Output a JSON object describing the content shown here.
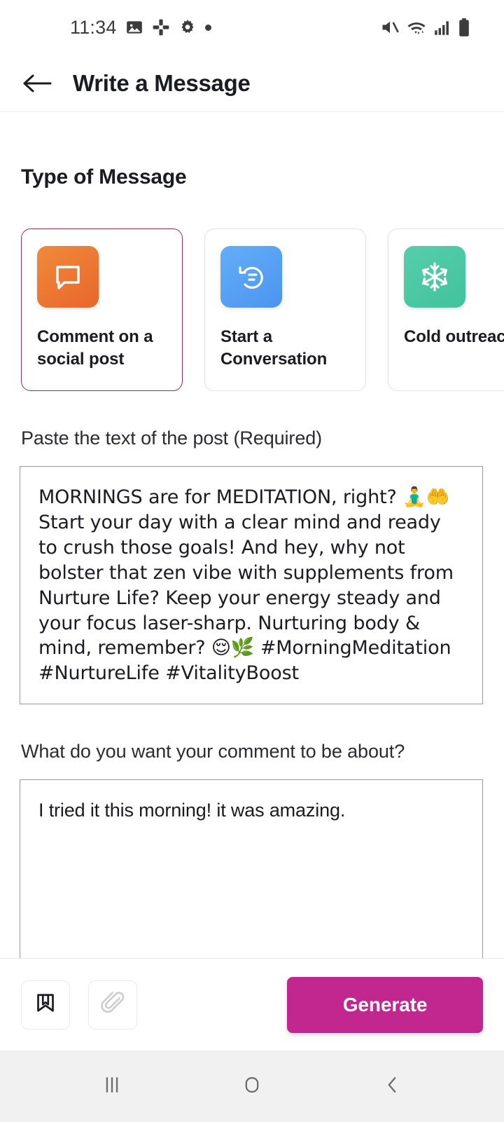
{
  "status_bar": {
    "time": "11:34",
    "left_icons": [
      "image-icon",
      "slack-icon",
      "gear-icon",
      "dot-icon"
    ],
    "right_icons": [
      "mute-icon",
      "wifi-icon",
      "signal-icon",
      "battery-icon"
    ]
  },
  "app_bar": {
    "back_icon": "back-arrow-icon",
    "title": "Write a Message"
  },
  "main": {
    "section_title": "Type of Message",
    "message_types": [
      {
        "label": "Comment on a\nsocial post",
        "icon": "speech-bubble-icon",
        "color": "#e8662a",
        "selected": true
      },
      {
        "label": "Start a\nConversation",
        "icon": "conversation-reply-icon",
        "color": "#4c94f0",
        "selected": false
      },
      {
        "label": "Cold outreach",
        "icon": "snowflake-icon",
        "color": "#41c29d",
        "selected": false
      }
    ],
    "post_field": {
      "label": "Paste the text of the post (Required)",
      "value": "MORNINGS are for MEDITATION, right? 🧘‍♂️🤲\nStart your day with a clear mind and ready to crush those goals! And hey, why not bolster that zen vibe with supplements from Nurture Life? Keep your energy steady and your focus laser-sharp. Nurturing body & mind, remember? 😌🌿 #MorningMeditation #NurtureLife #VitalityBoost",
      "placeholder": ""
    },
    "about_field": {
      "label": "What do you want your comment to be about?",
      "value": "I tried it this morning! it was amazing.",
      "placeholder": ""
    }
  },
  "action_bar": {
    "bookmark_icon": "bookmark-icon",
    "attach_icon": "paperclip-icon",
    "generate_label": "Generate",
    "generate_color": "#c2268f"
  },
  "nav_bar": {
    "recents_icon": "recents-icon",
    "home_icon": "home-icon",
    "back_icon": "back-icon"
  }
}
